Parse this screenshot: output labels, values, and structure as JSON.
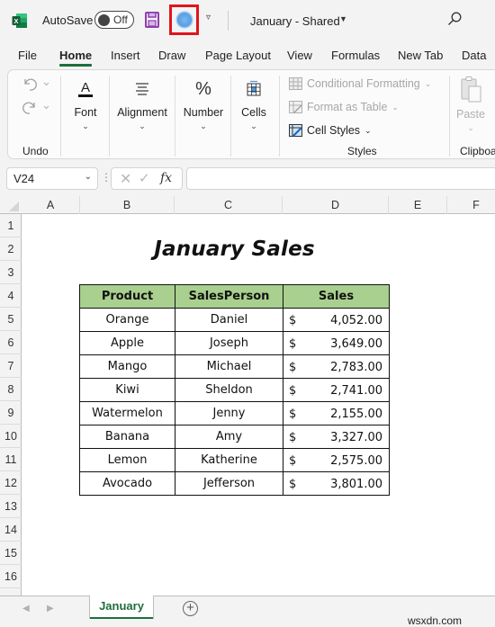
{
  "titlebar": {
    "app_icon": "excel-icon",
    "autosave_label": "AutoSave",
    "autosave_state": "Off",
    "save_icon": "save-icon",
    "highlighted_button_icon": "circle-icon",
    "quick_access_more": "customize-quick-access-icon",
    "document_title": "January  -  Shared",
    "search_icon": "search-icon"
  },
  "menu_tabs": [
    {
      "label": "File",
      "active": false
    },
    {
      "label": "Home",
      "active": true
    },
    {
      "label": "Insert",
      "active": false
    },
    {
      "label": "Draw",
      "active": false
    },
    {
      "label": "Page Layout",
      "active": false
    },
    {
      "label": "View",
      "active": false
    },
    {
      "label": "Formulas",
      "active": false
    },
    {
      "label": "New Tab",
      "active": false
    },
    {
      "label": "Data",
      "active": false
    }
  ],
  "ribbon": {
    "undo_group_label": "Undo",
    "font_label": "Font",
    "alignment_label": "Alignment",
    "number_label": "Number",
    "number_icon": "%",
    "cells_label": "Cells",
    "styles": {
      "conditional_formatting": "Conditional Formatting",
      "format_as_table": "Format as Table",
      "cell_styles": "Cell Styles",
      "group_label": "Styles"
    },
    "clipboard": {
      "paste_label": "Paste",
      "group_label": "Clipboa"
    }
  },
  "formula_bar": {
    "name_box": "V24",
    "formula_value": ""
  },
  "columns": [
    "A",
    "B",
    "C",
    "D",
    "E",
    "F"
  ],
  "rows": [
    "1",
    "2",
    "3",
    "4",
    "5",
    "6",
    "7",
    "8",
    "9",
    "10",
    "11",
    "12",
    "13",
    "14",
    "15",
    "16"
  ],
  "sheet": {
    "title": "January Sales",
    "headers": [
      "Product",
      "SalesPerson",
      "Sales"
    ],
    "header_fill": "#A9D08E",
    "currency_symbol": "$",
    "records": [
      {
        "product": "Orange",
        "salesperson": "Daniel",
        "sales": "4,052.00"
      },
      {
        "product": "Apple",
        "salesperson": "Joseph",
        "sales": "3,649.00"
      },
      {
        "product": "Mango",
        "salesperson": "Michael",
        "sales": "2,783.00"
      },
      {
        "product": "Kiwi",
        "salesperson": "Sheldon",
        "sales": "2,741.00"
      },
      {
        "product": "Watermelon",
        "salesperson": "Jenny",
        "sales": "2,155.00"
      },
      {
        "product": "Banana",
        "salesperson": "Amy",
        "sales": "3,327.00"
      },
      {
        "product": "Lemon",
        "salesperson": "Katherine",
        "sales": "2,575.00"
      },
      {
        "product": "Avocado",
        "salesperson": "Jefferson",
        "sales": "3,801.00"
      }
    ]
  },
  "sheet_tabs": {
    "tabs": [
      "January"
    ],
    "active": "January",
    "accent_color": "#1E6E3E"
  },
  "watermark": "wsxdn.com"
}
